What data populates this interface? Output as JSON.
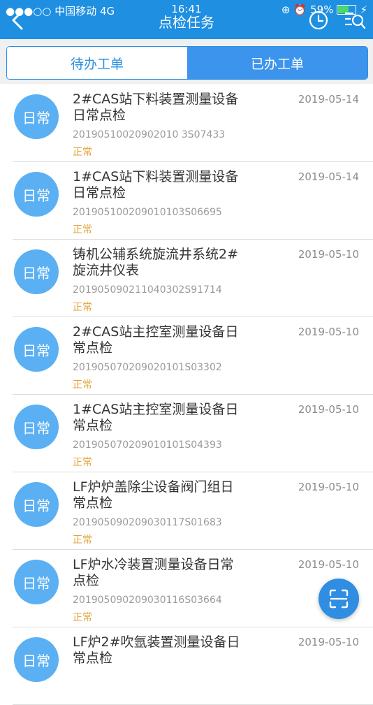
{
  "status_bar": {
    "carrier": "●●●○○ 中国移动  4G",
    "time": "16:41",
    "battery": "59%",
    "battery_level": 0.59
  },
  "header": {
    "title": "点检任务"
  },
  "tabs": [
    {
      "label": "待办工单",
      "active": false
    },
    {
      "label": "已办工单",
      "active": true
    }
  ],
  "tasks": [
    {
      "badge": "日常",
      "title": "2#CAS站下料装置测量设备日常点检",
      "code": "20190510020902010 3S07433",
      "state": "正常",
      "date": "2019-05-14"
    },
    {
      "badge": "日常",
      "title": "1#CAS站下料装置测量设备日常点检",
      "code": "201905100209010103S06695",
      "state": "正常",
      "date": "2019-05-14"
    },
    {
      "badge": "日常",
      "title": "铸机公辅系统旋流井系统2#旋流井仪表",
      "code": "201905090211040302S91714",
      "state": "正常",
      "date": "2019-05-10"
    },
    {
      "badge": "日常",
      "title": "2#CAS站主控室测量设备日常点检",
      "code": "201905070209020101S03302",
      "state": "正常",
      "date": "2019-05-10"
    },
    {
      "badge": "日常",
      "title": "1#CAS站主控室测量设备日常点检",
      "code": "201905070209010101S04393",
      "state": "正常",
      "date": "2019-05-10"
    },
    {
      "badge": "日常",
      "title": "LF炉炉盖除尘设备阀门组日常点检",
      "code": "201905090209030117S01683",
      "state": "正常",
      "date": "2019-05-10"
    },
    {
      "badge": "日常",
      "title": "LF炉水冷装置测量设备日常点检",
      "code": "201905090209030116S03664",
      "state": "正常",
      "date": "2019-05-10"
    },
    {
      "badge": "日常",
      "title": "LF炉2#吹氩装置测量设备日常点检",
      "code": "",
      "state": "",
      "date": "2019-05-10"
    }
  ]
}
